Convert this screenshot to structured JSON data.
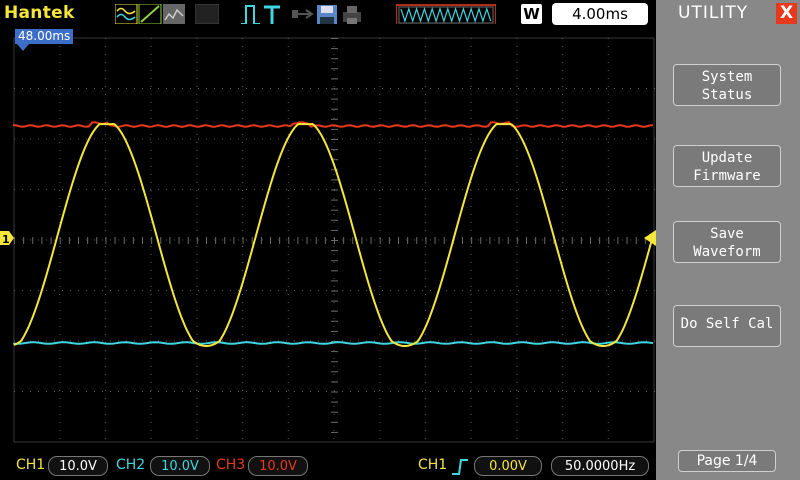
{
  "brand": "Hantek",
  "timebase": "4.00ms",
  "trigger_position": "48.00ms",
  "trigger_mode_badge": "W",
  "channel_marker": "1",
  "menu": {
    "title": "UTILITY",
    "close_symbol": "X",
    "items": [
      {
        "line1": "System",
        "line2": "Status"
      },
      {
        "line1": "Update",
        "line2": "Firmware"
      },
      {
        "line1": "Save",
        "line2": "Waveform"
      },
      {
        "line1": "Do Self Cal",
        "line2": ""
      }
    ],
    "page": "Page 1/4"
  },
  "status": {
    "ch1_label": "CH1",
    "ch1_scale": "10.0V",
    "ch2_label": "CH2",
    "ch2_scale": "10.0V",
    "ch3_label": "CH3",
    "ch3_scale": "10.0V",
    "trig_source": "CH1",
    "trig_level": "0.00V",
    "trig_freq": "50.0000Hz"
  },
  "colors": {
    "ch1": "#f5e63c",
    "ch2": "#3fd6e0",
    "ch3": "#e8391d",
    "trigger": "#3c6ec8",
    "menu_bg": "#888888"
  }
}
